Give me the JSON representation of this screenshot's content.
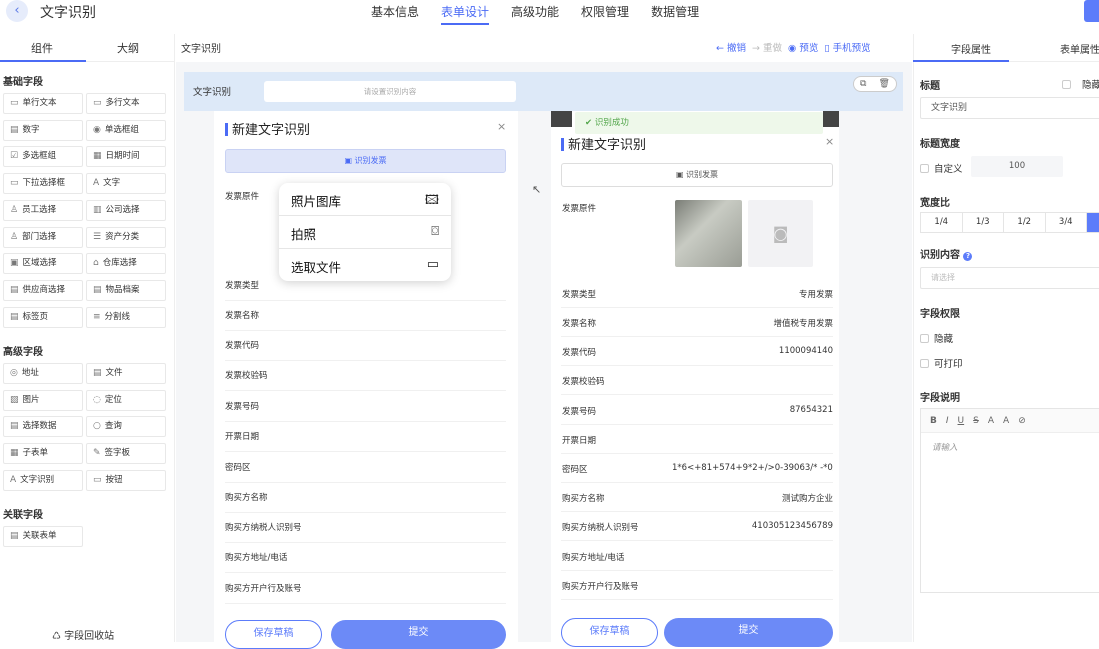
{
  "header": {
    "back_icon": "arrow-left-icon",
    "title": "文字识别",
    "tabs": [
      "基本信息",
      "表单设计",
      "高级功能",
      "权限管理",
      "数据管理"
    ]
  },
  "left_panel": {
    "tabs": [
      "组件",
      "大纲"
    ],
    "basic": {
      "title": "基础字段",
      "items": [
        {
          "icon": "▭",
          "label": "单行文本"
        },
        {
          "icon": "▭",
          "label": "多行文本"
        },
        {
          "icon": "▤",
          "label": "数字"
        },
        {
          "icon": "◉",
          "label": "单选框组"
        },
        {
          "icon": "☑",
          "label": "多选框组"
        },
        {
          "icon": "▦",
          "label": "日期时间"
        },
        {
          "icon": "▭",
          "label": "下拉选择框"
        },
        {
          "icon": "A",
          "label": "文字"
        },
        {
          "icon": "♙",
          "label": "员工选择"
        },
        {
          "icon": "▥",
          "label": "公司选择"
        },
        {
          "icon": "♙",
          "label": "部门选择"
        },
        {
          "icon": "☰",
          "label": "资产分类"
        },
        {
          "icon": "▣",
          "label": "区域选择"
        },
        {
          "icon": "⌂",
          "label": "仓库选择"
        },
        {
          "icon": "▤",
          "label": "供应商选择"
        },
        {
          "icon": "▤",
          "label": "物品档案"
        },
        {
          "icon": "▤",
          "label": "标签页"
        },
        {
          "icon": "≡",
          "label": "分割线"
        }
      ]
    },
    "advanced": {
      "title": "高级字段",
      "items": [
        {
          "icon": "◎",
          "label": "地址"
        },
        {
          "icon": "▤",
          "label": "文件"
        },
        {
          "icon": "▨",
          "label": "图片"
        },
        {
          "icon": "◌",
          "label": "定位"
        },
        {
          "icon": "▤",
          "label": "选择数据"
        },
        {
          "icon": "○",
          "label": "查询"
        },
        {
          "icon": "▦",
          "label": "子表单"
        },
        {
          "icon": "✎",
          "label": "签字板"
        },
        {
          "icon": "A",
          "label": "文字识别"
        },
        {
          "icon": "▭",
          "label": "按钮"
        }
      ]
    },
    "related": {
      "title": "关联字段",
      "items": [
        {
          "icon": "▤",
          "label": "关联表单"
        }
      ]
    },
    "recycle_bin": "字段回收站"
  },
  "canvas": {
    "title": "文字识别",
    "toolbar": {
      "undo": "撤销",
      "redo": "重做",
      "preview": "预览",
      "mobile_preview": "手机预览"
    },
    "selected_field": {
      "label": "文字识别",
      "placeholder": "请设置识别内容"
    },
    "left_phone": {
      "title": "新建文字识别",
      "recognize_button": "识别发票",
      "fields": [
        "发票原件",
        "发票类型",
        "发票名称",
        "发票代码",
        "发票校验码",
        "发票号码",
        "开票日期",
        "密码区",
        "购买方名称",
        "购买方纳税人识别号",
        "购买方地址/电话",
        "购买方开户行及账号"
      ],
      "draft": "保存草稿",
      "submit": "提交"
    },
    "popup": {
      "items": [
        {
          "label": "照片图库",
          "icon": "photo-library-icon"
        },
        {
          "label": "拍照",
          "icon": "camera-icon"
        },
        {
          "label": "选取文件",
          "icon": "folder-icon"
        }
      ]
    },
    "right_phone": {
      "toast": "识别成功",
      "title": "新建文字识别",
      "recognize_button": "识别发票",
      "fields": [
        {
          "label": "发票原件",
          "value": ""
        },
        {
          "label": "发票类型",
          "value": "专用发票"
        },
        {
          "label": "发票名称",
          "value": "增值税专用发票"
        },
        {
          "label": "发票代码",
          "value": "1100094140"
        },
        {
          "label": "发票校验码",
          "value": ""
        },
        {
          "label": "发票号码",
          "value": "87654321"
        },
        {
          "label": "开票日期",
          "value": ""
        },
        {
          "label": "密码区",
          "value": "1*6<+81+574+9*2+/>0-39063/* -*0/"
        },
        {
          "label": "购买方名称",
          "value": "测试购方企业"
        },
        {
          "label": "购买方纳税人识别号",
          "value": "410305123456789"
        },
        {
          "label": "购买方地址/电话",
          "value": ""
        },
        {
          "label": "购买方开户行及账号",
          "value": ""
        }
      ],
      "draft": "保存草稿",
      "submit": "提交"
    }
  },
  "right_panel": {
    "tabs": [
      "字段属性",
      "表单属性"
    ],
    "title_label": "标题",
    "hide_label": "隐藏",
    "title_value": "文字识别",
    "title_width_label": "标题宽度",
    "custom_label": "自定义",
    "custom_value": "100",
    "width_ratio_label": "宽度比",
    "ratios": [
      "1/4",
      "1/3",
      "1/2",
      "3/4"
    ],
    "recognize_content_label": "识别内容",
    "recognize_placeholder": "请选择",
    "field_permission_label": "字段权限",
    "perm_hidden": "隐藏",
    "perm_printable": "可打印",
    "field_desc_label": "字段说明",
    "editor_tools": [
      "B",
      "I",
      "U",
      "S",
      "A",
      "A",
      "⊘"
    ],
    "editor_placeholder": "请输入"
  }
}
